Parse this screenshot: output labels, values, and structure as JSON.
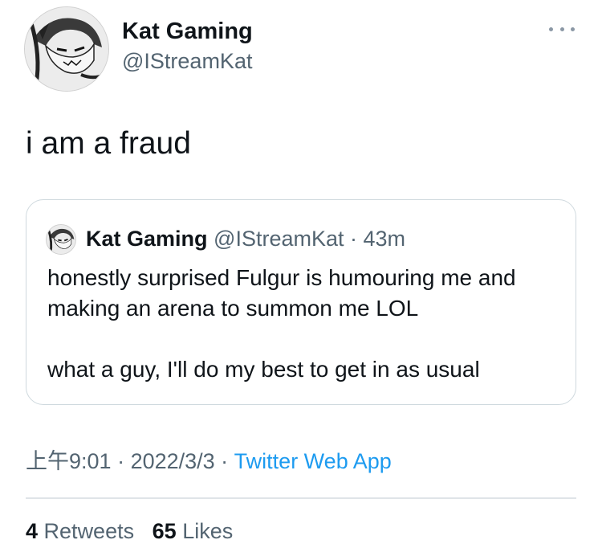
{
  "author": {
    "display_name": "Kat Gaming",
    "handle": "@IStreamKat",
    "avatar_icon": "manga-avatar-icon"
  },
  "menu": {
    "icon": "more-horizontal-icon"
  },
  "tweet": {
    "text": "i am a fraud"
  },
  "quoted_tweet": {
    "display_name": "Kat Gaming",
    "handle": "@IStreamKat",
    "separator": " · ",
    "time": "43m",
    "text": "honestly surprised Fulgur is humouring me and making an arena to summon me LOL\n\nwhat a guy, I'll do my best to get in as usual"
  },
  "meta": {
    "time": "上午9:01",
    "date": "2022/3/3",
    "separator": " · ",
    "source": "Twitter Web App"
  },
  "stats": {
    "retweets_count": "4",
    "retweets_label": "Retweets",
    "likes_count": "65",
    "likes_label": "Likes"
  },
  "colors": {
    "text_primary": "#0f1419",
    "text_secondary": "#536471",
    "link": "#1d9bf0",
    "border": "#cfd9de"
  }
}
